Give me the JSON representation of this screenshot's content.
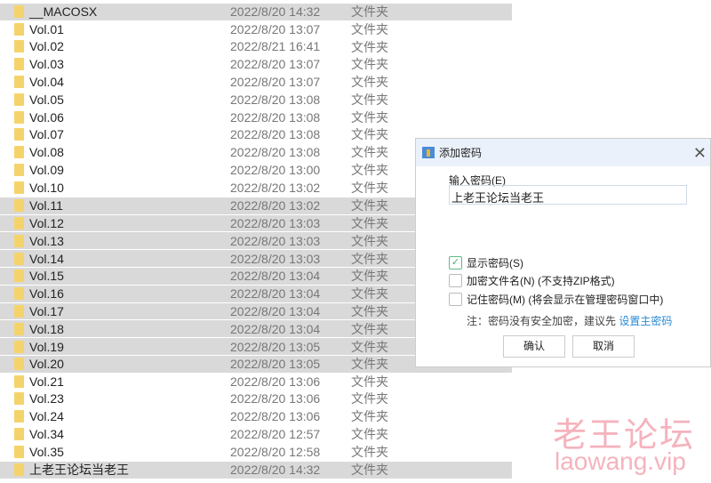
{
  "files": [
    {
      "name": "__MACOSX",
      "date": "2022/8/20 14:32",
      "type": "文件夹",
      "selected": true
    },
    {
      "name": "Vol.01",
      "date": "2022/8/20 13:07",
      "type": "文件夹",
      "selected": false
    },
    {
      "name": "Vol.02",
      "date": "2022/8/21 16:41",
      "type": "文件夹",
      "selected": false
    },
    {
      "name": "Vol.03",
      "date": "2022/8/20 13:07",
      "type": "文件夹",
      "selected": false
    },
    {
      "name": "Vol.04",
      "date": "2022/8/20 13:07",
      "type": "文件夹",
      "selected": false
    },
    {
      "name": "Vol.05",
      "date": "2022/8/20 13:08",
      "type": "文件夹",
      "selected": false
    },
    {
      "name": "Vol.06",
      "date": "2022/8/20 13:08",
      "type": "文件夹",
      "selected": false
    },
    {
      "name": "Vol.07",
      "date": "2022/8/20 13:08",
      "type": "文件夹",
      "selected": false
    },
    {
      "name": "Vol.08",
      "date": "2022/8/20 13:08",
      "type": "文件夹",
      "selected": false
    },
    {
      "name": "Vol.09",
      "date": "2022/8/20 13:00",
      "type": "文件夹",
      "selected": false
    },
    {
      "name": "Vol.10",
      "date": "2022/8/20 13:02",
      "type": "文件夹",
      "selected": false
    },
    {
      "name": "Vol.11",
      "date": "2022/8/20 13:02",
      "type": "文件夹",
      "selected": true
    },
    {
      "name": "Vol.12",
      "date": "2022/8/20 13:03",
      "type": "文件夹",
      "selected": true
    },
    {
      "name": "Vol.13",
      "date": "2022/8/20 13:03",
      "type": "文件夹",
      "selected": true
    },
    {
      "name": "Vol.14",
      "date": "2022/8/20 13:03",
      "type": "文件夹",
      "selected": true
    },
    {
      "name": "Vol.15",
      "date": "2022/8/20 13:04",
      "type": "文件夹",
      "selected": true
    },
    {
      "name": "Vol.16",
      "date": "2022/8/20 13:04",
      "type": "文件夹",
      "selected": true
    },
    {
      "name": "Vol.17",
      "date": "2022/8/20 13:04",
      "type": "文件夹",
      "selected": true
    },
    {
      "name": "Vol.18",
      "date": "2022/8/20 13:04",
      "type": "文件夹",
      "selected": true
    },
    {
      "name": "Vol.19",
      "date": "2022/8/20 13:05",
      "type": "文件夹",
      "selected": true
    },
    {
      "name": "Vol.20",
      "date": "2022/8/20 13:05",
      "type": "文件夹",
      "selected": true
    },
    {
      "name": "Vol.21",
      "date": "2022/8/20 13:06",
      "type": "文件夹",
      "selected": false
    },
    {
      "name": "Vol.23",
      "date": "2022/8/20 13:06",
      "type": "文件夹",
      "selected": false
    },
    {
      "name": "Vol.24",
      "date": "2022/8/20 13:06",
      "type": "文件夹",
      "selected": false
    },
    {
      "name": "Vol.34",
      "date": "2022/8/20 12:57",
      "type": "文件夹",
      "selected": false
    },
    {
      "name": "Vol.35",
      "date": "2022/8/20 12:58",
      "type": "文件夹",
      "selected": false
    },
    {
      "name": "上老王论坛当老王",
      "date": "2022/8/20 14:32",
      "type": "文件夹",
      "selected": true
    }
  ],
  "dialog": {
    "title": "添加密码",
    "password_label": "输入密码(E)",
    "password_value": "上老王论坛当老王",
    "show_password": {
      "label": "显示密码(S)",
      "checked": true
    },
    "encrypt_names": {
      "label": "加密文件名(N) (不支持ZIP格式)",
      "checked": false
    },
    "remember": {
      "label": "记住密码(M) (将会显示在管理密码窗口中)",
      "checked": false
    },
    "note": "注：密码没有安全加密，建议先",
    "note_link": "设置主密码",
    "ok": "确认",
    "cancel": "取消"
  },
  "watermark": {
    "cn": "老王论坛",
    "url": "laowang.vip"
  }
}
